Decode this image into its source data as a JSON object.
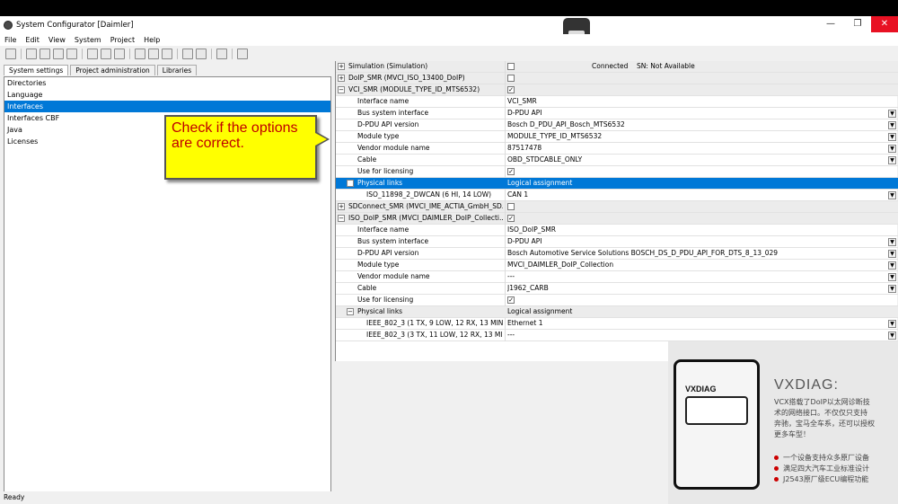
{
  "window": {
    "title": "System Configurator [Daimler]"
  },
  "menu": [
    "File",
    "Edit",
    "View",
    "System",
    "Project",
    "Help"
  ],
  "tabs": [
    "System settings",
    "Project administration",
    "Libraries"
  ],
  "left_items": [
    "Directories",
    "Language",
    "Interfaces",
    "Interfaces CBF",
    "Java",
    "Licenses"
  ],
  "selected_left_item": "Interfaces",
  "callout": {
    "line1": "Check if the options",
    "line2": "are correct."
  },
  "grid": {
    "r0": {
      "name": "Simulation (Simulation)",
      "col3": "Connected",
      "col4": "SN: Not Available"
    },
    "r1": {
      "name": "DoIP_SMR (MVCI_ISO_13400_DoIP)"
    },
    "r2": {
      "name": "VCI_SMR (MODULE_TYPE_ID_MTS6532)"
    },
    "r3": {
      "name": "Interface name",
      "value": "VCI_SMR"
    },
    "r4": {
      "name": "Bus system interface",
      "value": "D-PDU API"
    },
    "r5": {
      "name": "D-PDU API version",
      "value": "Bosch D_PDU_API_Bosch_MTS6532"
    },
    "r6": {
      "name": "Module type",
      "value": "MODULE_TYPE_ID_MTS6532"
    },
    "r7": {
      "name": "Vendor module name",
      "value": "87517478"
    },
    "r8": {
      "name": "Cable",
      "value": "OBD_STDCABLE_ONLY"
    },
    "r9": {
      "name": "Use for licensing"
    },
    "r10": {
      "name": "Physical links",
      "value": "Logical assignment"
    },
    "r11": {
      "name": "ISO_11898_2_DWCAN (6 HI, 14 LOW)",
      "value": "CAN 1"
    },
    "r12": {
      "name": "SDConnect_SMR (MVCI_IME_ACTIA_GmbH_SD..."
    },
    "r13": {
      "name": "ISO_DoIP_SMR (MVCI_DAIMLER_DoIP_Collecti..."
    },
    "r14": {
      "name": "Interface name",
      "value": "ISO_DoIP_SMR"
    },
    "r15": {
      "name": "Bus system interface",
      "value": "D-PDU API"
    },
    "r16": {
      "name": "D-PDU API version",
      "value": "Bosch Automotive Service Solutions BOSCH_DS_D_PDU_API_FOR_DTS_8_13_029"
    },
    "r17": {
      "name": "Module type",
      "value": "MVCI_DAIMLER_DoIP_Collection"
    },
    "r18": {
      "name": "Vendor module name",
      "value": "---"
    },
    "r19": {
      "name": "Cable",
      "value": "J1962_CARB"
    },
    "r20": {
      "name": "Use for licensing"
    },
    "r21": {
      "name": "Physical links",
      "value": "Logical assignment"
    },
    "r22": {
      "name": "IEEE_802_3 (1 TX, 9 LOW, 12 RX, 13 MIN...",
      "value": "Ethernet 1"
    },
    "r23": {
      "name": "IEEE_802_3 (3 TX, 11 LOW, 12 RX, 13 MIN...",
      "value": "---"
    }
  },
  "status": "Ready",
  "ad": {
    "brand": "VXDIAG",
    "title": "VXDIAG:",
    "line1": "VCX搭载了DoIP以太网诊断技",
    "line2": "术的网络接口。不仅仅只支持",
    "line3": "奔驰，宝马全车系，还可以授权",
    "line4": "更多车型！",
    "b1": "一个设备支持众多原厂设备",
    "b2": "满足四大汽车工业标准设计",
    "b3": "J2543原厂级ECU编程功能"
  }
}
